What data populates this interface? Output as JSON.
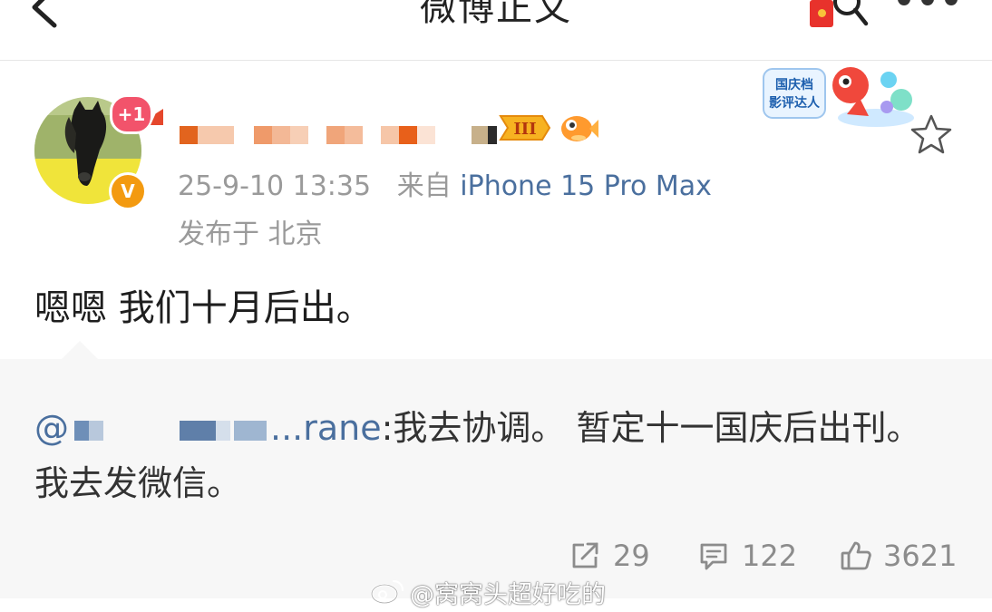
{
  "nav": {
    "title": "微博正文"
  },
  "post": {
    "notification_badge": "+1",
    "verified_mark": "V",
    "level_badge": "III",
    "timestamp": "25-9-10 13:35",
    "source_prefix": "来自",
    "source_device": "iPhone 15 Pro Max",
    "location": "发布于 北京",
    "text": "嗯嗯 我们十月后出。"
  },
  "sticker": {
    "line1": "国庆档",
    "line2": "影评达人"
  },
  "repost": {
    "mention_prefix": "@",
    "mention_suffix": "...rane",
    "line1_text": ":我去协调。 暂定十一国庆后出刊。",
    "line2_text": "我去发微信。"
  },
  "actions": {
    "reposts": "29",
    "comments": "122",
    "likes": "3621"
  },
  "watermark": "@窝窝头超好吃的",
  "colors": {
    "link": "#4a6f9e",
    "meta_gray": "#9a9a9a",
    "badge_red": "#f2536b",
    "verified_orange": "#f39a10"
  }
}
